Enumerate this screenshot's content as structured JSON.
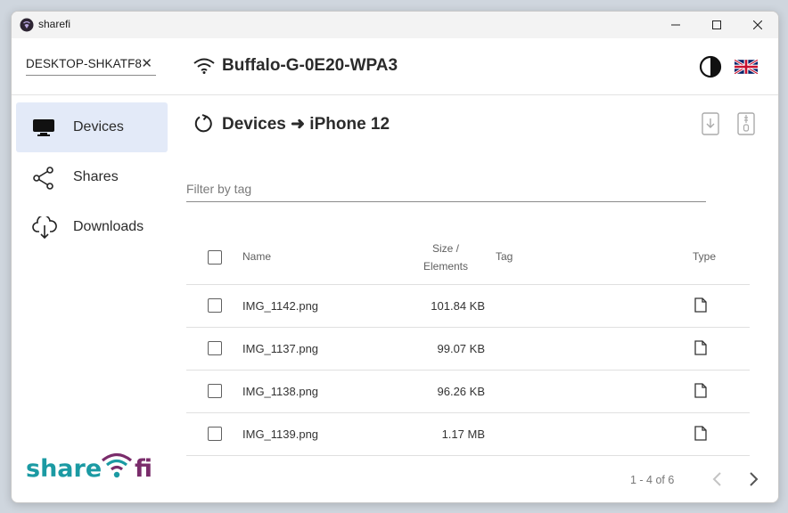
{
  "window": {
    "title": "sharefi"
  },
  "header": {
    "hostname": "DESKTOP-SHKATF8",
    "network": "Buffalo-G-0E20-WPA3"
  },
  "sidebar": {
    "items": [
      {
        "label": "Devices",
        "icon": "monitor-icon",
        "active": true
      },
      {
        "label": "Shares",
        "icon": "share-icon",
        "active": false
      },
      {
        "label": "Downloads",
        "icon": "cloud-download-icon",
        "active": false
      }
    ],
    "logo": {
      "text": "share fi"
    }
  },
  "main": {
    "breadcrumb": "Devices ➜ iPhone 12",
    "filter_placeholder": "Filter by tag",
    "table": {
      "headers": {
        "name": "Name",
        "size": "Size / Elements",
        "tag": "Tag",
        "type": "Type"
      },
      "rows": [
        {
          "name": "IMG_1142.png",
          "size": "101.84 KB",
          "tag": "",
          "type": "file-icon"
        },
        {
          "name": "IMG_1137.png",
          "size": "99.07 KB",
          "tag": "",
          "type": "file-icon"
        },
        {
          "name": "IMG_1138.png",
          "size": "96.26 KB",
          "tag": "",
          "type": "file-icon"
        },
        {
          "name": "IMG_1139.png",
          "size": "1.17 MB",
          "tag": "",
          "type": "file-icon"
        }
      ]
    },
    "pagination": "1 - 4 of 6"
  },
  "colors": {
    "active_nav_bg": "#e3eaf8",
    "logo_teal": "#1b9aa3",
    "logo_purple": "#7a2c6b"
  }
}
